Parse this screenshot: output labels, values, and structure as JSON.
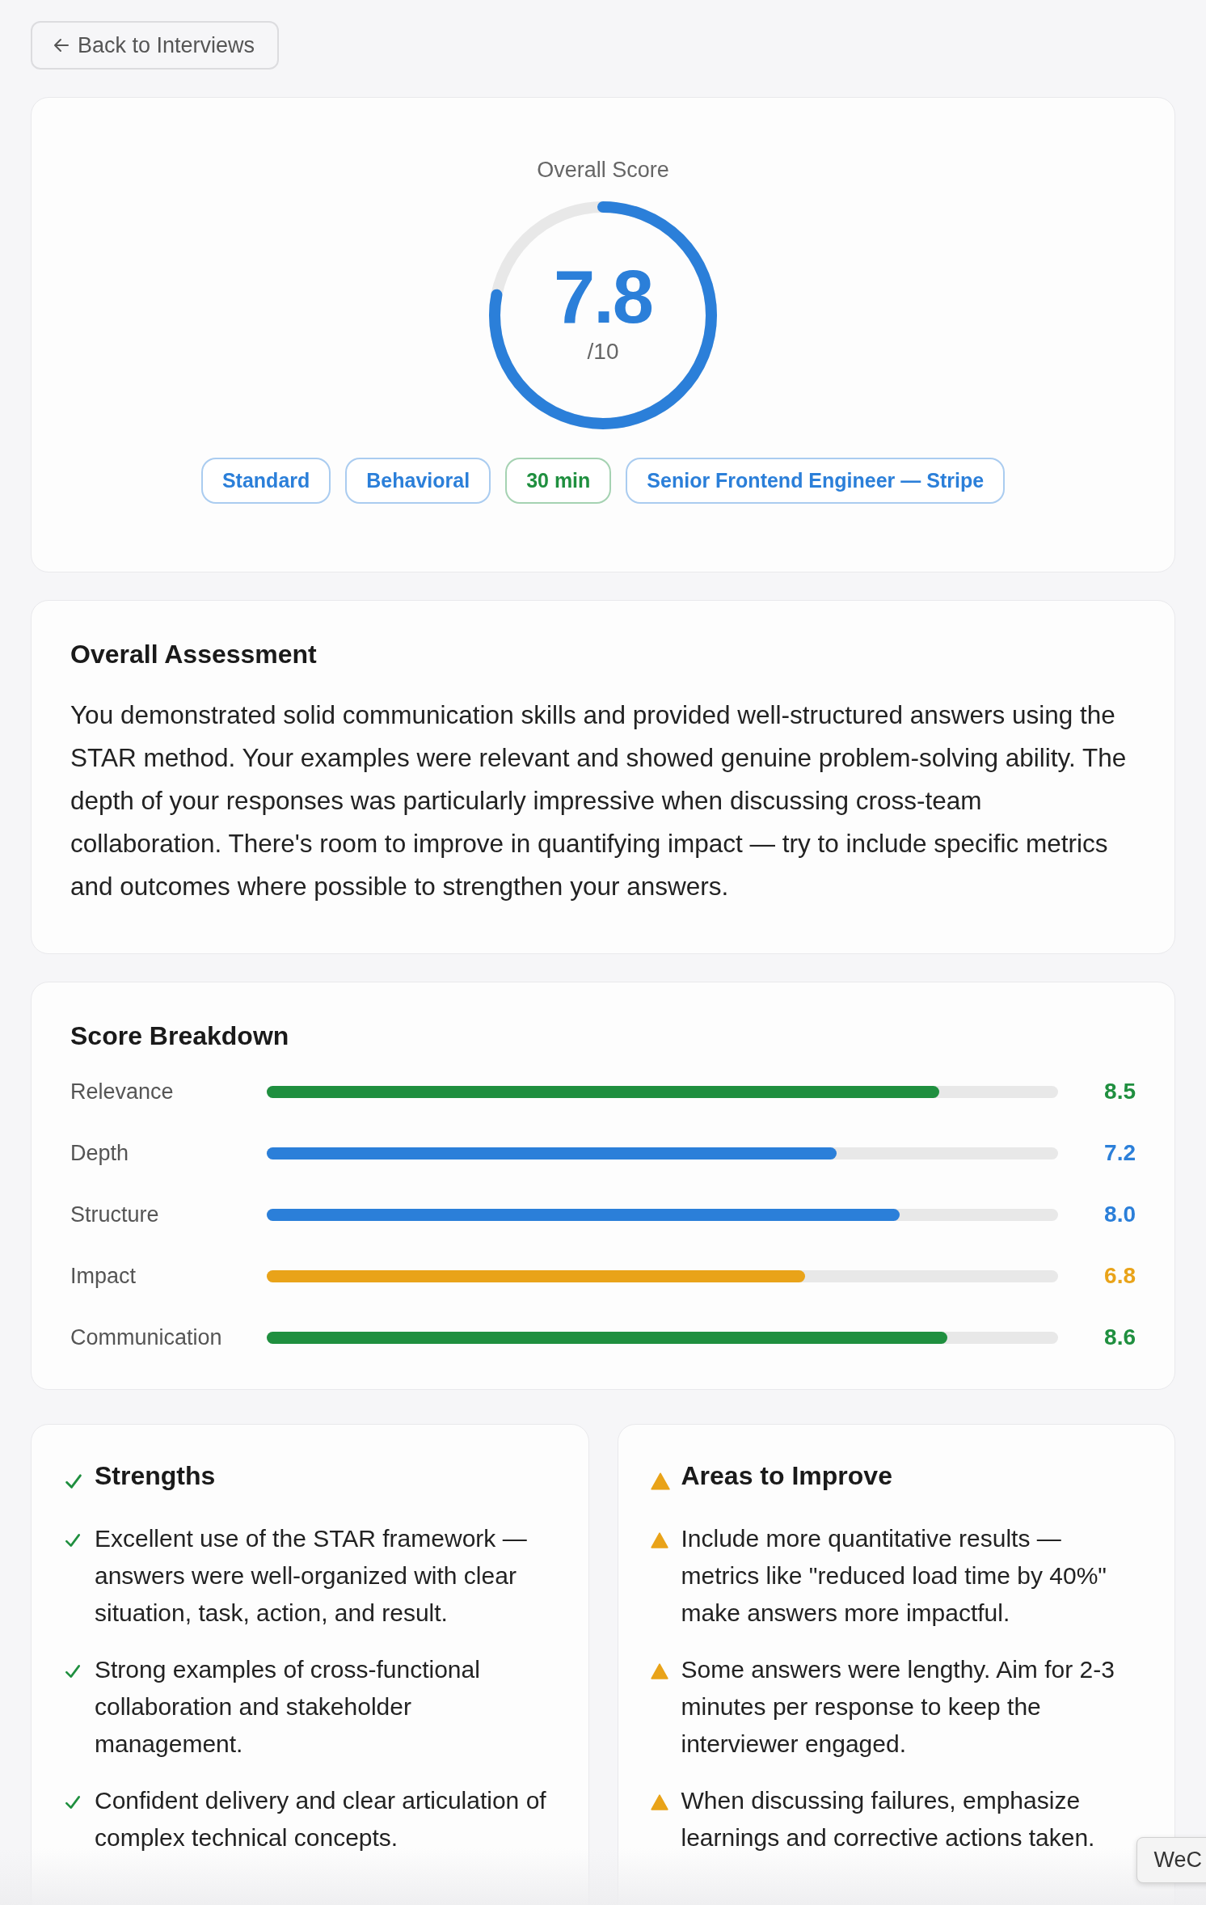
{
  "back_button": {
    "label": "Back to Interviews"
  },
  "overall_score": {
    "title": "Overall Score",
    "score": "7.8",
    "scale": "/10",
    "level": 0.78,
    "tags": [
      {
        "label": "Standard",
        "color": "#2b7fd9"
      },
      {
        "label": "Behavioral",
        "color": "#2b7fd9"
      },
      {
        "label": "30 min",
        "color": "#1f8f3f"
      },
      {
        "label": "Senior Frontend Engineer — Stripe",
        "color": "#2b7fd9"
      }
    ]
  },
  "assessment": {
    "title": "Overall Assessment",
    "text": "You demonstrated solid communication skills and provided well-structured answers using the STAR method. Your examples were relevant and showed genuine problem-solving ability. The depth of your responses was particularly impressive when discussing cross-team collaboration. There's room to improve in quantifying impact — try to include specific metrics and outcomes where possible to strengthen your answers."
  },
  "breakdown": {
    "title": "Score Breakdown",
    "items": [
      {
        "name": "Relevance",
        "level": 0.85,
        "reading": "8.5",
        "color": "#1f8f3f"
      },
      {
        "name": "Depth",
        "level": 0.72,
        "reading": "7.2",
        "color": "#2b7fd9"
      },
      {
        "name": "Structure",
        "level": 0.8,
        "reading": "8.0",
        "color": "#2b7fd9"
      },
      {
        "name": "Impact",
        "level": 0.68,
        "reading": "6.8",
        "color": "#e9a319"
      },
      {
        "name": "Communication",
        "level": 0.86,
        "reading": "8.6",
        "color": "#1f8f3f"
      }
    ]
  },
  "feedback": [
    {
      "kind": "strengths",
      "title": "Strengths",
      "items": [
        "Excellent use of the STAR framework — answers were well-organized with clear situation, task, action, and result.",
        "Strong examples of cross-functional collaboration and stakeholder management.",
        "Confident delivery and clear articulation of complex technical concepts."
      ]
    },
    {
      "kind": "improve",
      "title": "Areas to Improve",
      "items": [
        "Include more quantitative results — metrics like \"reduced load time by 40%\" make answers more impactful.",
        "Some answers were lengthy. Aim for 2-3 minutes per response to keep the interviewer engaged.",
        "When discussing failures, emphasize learnings and corrective actions taken."
      ]
    }
  ],
  "tooltip": {
    "text": "WeC"
  }
}
